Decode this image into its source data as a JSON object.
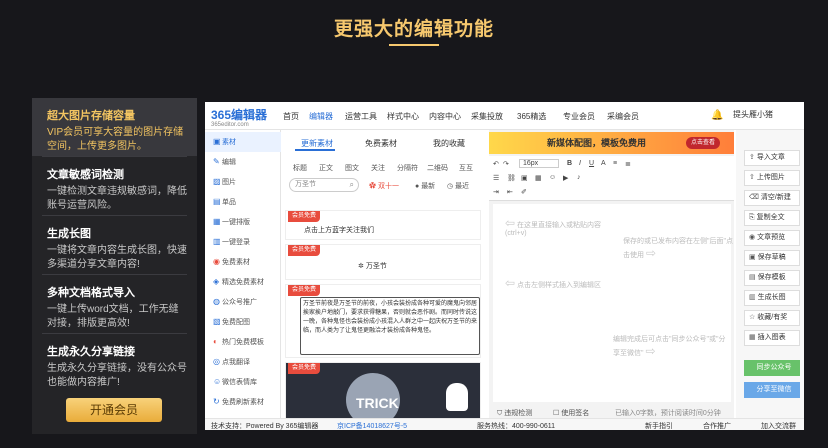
{
  "headline": "更强大的编辑功能",
  "features": [
    {
      "title": "超大图片存储容量",
      "desc": "VIP会员可享大容量的图片存储空间，上传更多图片。"
    },
    {
      "title": "文章敏感词检测",
      "desc": "一键检测文章违规敏感词，降低账号运营风险。"
    },
    {
      "title": "生成长图",
      "desc": "一键将文章内容生成长图，快速多渠道分享文章内容!"
    },
    {
      "title": "多种文档格式导入",
      "desc": "一键上传word文档，工作无缝对接，排版更高效!"
    },
    {
      "title": "生成永久分享链接",
      "desc": "生成永久分享链接，没有公众号也能做内容推广!"
    }
  ],
  "vip_button": "开通会员",
  "app": {
    "logo": "365编辑器",
    "logo_sub": "365editor.com",
    "nav": [
      "首页",
      "编辑器",
      "运营工具",
      "样式中心",
      "内容中心",
      "采集投放",
      "365精选",
      "专业会员",
      "采编会员"
    ],
    "user": "提头雁小猪",
    "sidebar": [
      "素材",
      "编辑",
      "图片",
      "单品",
      "一键排版",
      "一键登录",
      "免费素材",
      "精选免费素材",
      "公众号推广",
      "免费配图",
      "热门免费模板",
      "点我翻译",
      "微信表情库",
      "免费刷新素材"
    ],
    "mat_tabs": [
      "更新素材",
      "免费素材",
      "我的收藏"
    ],
    "chips": [
      "标题",
      "正文",
      "图文",
      "关注",
      "分隔符",
      "二维码",
      "互互"
    ],
    "search_placeholder": "万圣节",
    "filters": [
      "双十一",
      "最新",
      "最近"
    ],
    "card_badge": "会员免费",
    "card1_text": "点击上方蓝字关注我们",
    "card2_title": "万圣节",
    "card3_text": "万圣节前夜是万圣节的前夜，小孩会装扮成各种可爱的魔鬼向邻居挨家挨户地敲门，要求获得糖果，否则就会恶作剧。而同时传说这一晚，各种鬼怪也会装扮成小孩混入人群之中一起庆祝万圣节的来临，而人类为了让鬼怪更融洽才装扮成各种鬼怪。",
    "card4_text": "TRICK",
    "banner_text": "新媒体配图，模板免费用",
    "banner_btn": "点击查看",
    "font_size": "16px",
    "hint1": "在这里直接输入或粘贴内容(ctrl+v)",
    "hint2": "保存的或已发布内容在左侧\"后面\"点击使用",
    "hint3": "点击左侧样式插入到编辑区",
    "hint4": "编辑完成后可点击\"同步公众号\"或\"分享至微信\"",
    "ed_foot": [
      "违规检测",
      "使用签名",
      "已输入0字数，预计阅读时间0分钟"
    ],
    "right_buttons": [
      "导入文章",
      "上传图片",
      "清空/新建",
      "复制全文",
      "文章预览",
      "保存草稿",
      "保存模板",
      "生成长图",
      "收藏/有奖",
      "插入图表"
    ],
    "sync": "同步公众号",
    "share": "分享至微信",
    "footer": {
      "left": "技术支持：Powered By 365编辑器",
      "icp": "京ICP备14018627号-5",
      "phone": "服务热线：400-990-0611",
      "b1": "新手指引",
      "b2": "合作推广",
      "b3": "加入交流群"
    }
  }
}
